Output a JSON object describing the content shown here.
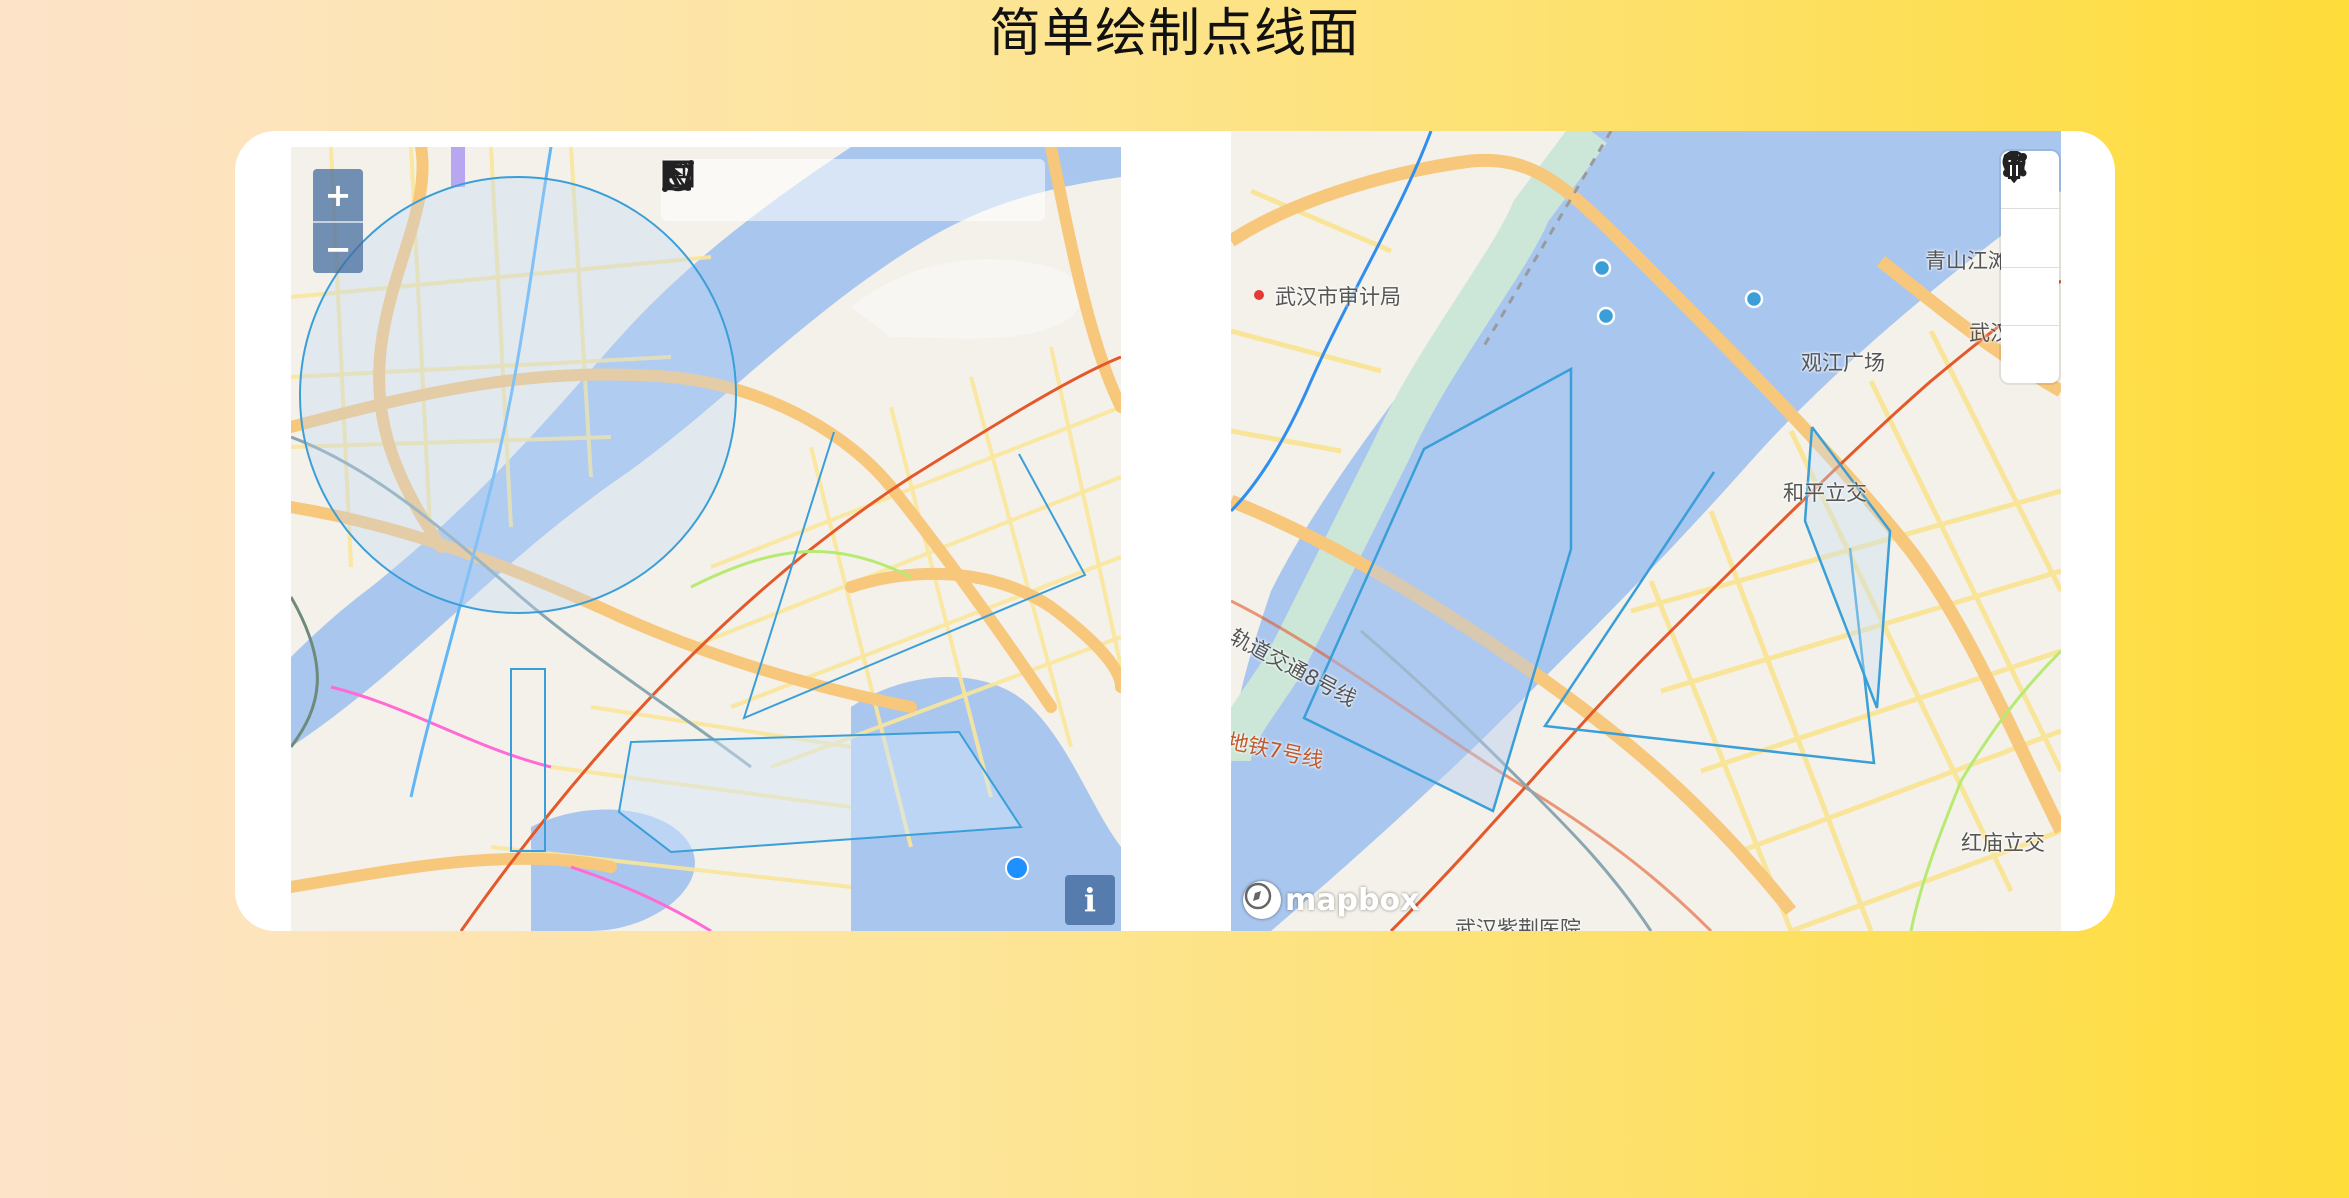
{
  "page": {
    "title": "简单绘制点线面"
  },
  "left_map": {
    "zoom_in_label": "+",
    "zoom_out_label": "−",
    "info_label": "i",
    "toolbar_tools": [
      "select-tool",
      "point-tool",
      "line-tool",
      "polygon-tool",
      "circle-tool",
      "rectangle-tool",
      "trash-tool"
    ]
  },
  "right_map": {
    "attribution": "mapbox",
    "labels": {
      "audit_bureau": "武汉市审计局",
      "guanjiang_square": "观江广场",
      "qingshan_jiangtan": "青山江滩",
      "wuhan_partial": "武汉",
      "heping_interchange": "和平立交",
      "metro_line_8": "轨道交通8号线",
      "metro_line_7": "地铁7号线",
      "hongmiao_interchange": "红庙立交",
      "hospital": "武汉紫荆医院"
    },
    "draw_controls": [
      "line-string",
      "polygon",
      "point",
      "trash"
    ]
  },
  "colors": {
    "draw_stroke": "#3a9fd8",
    "water": "#a9c6ee",
    "land": "#f4f1ea",
    "major_road": "#f7c77c",
    "arterial": "#f9e59a",
    "metro_line": "#e4582a",
    "accent_point": "#1e90ff"
  }
}
